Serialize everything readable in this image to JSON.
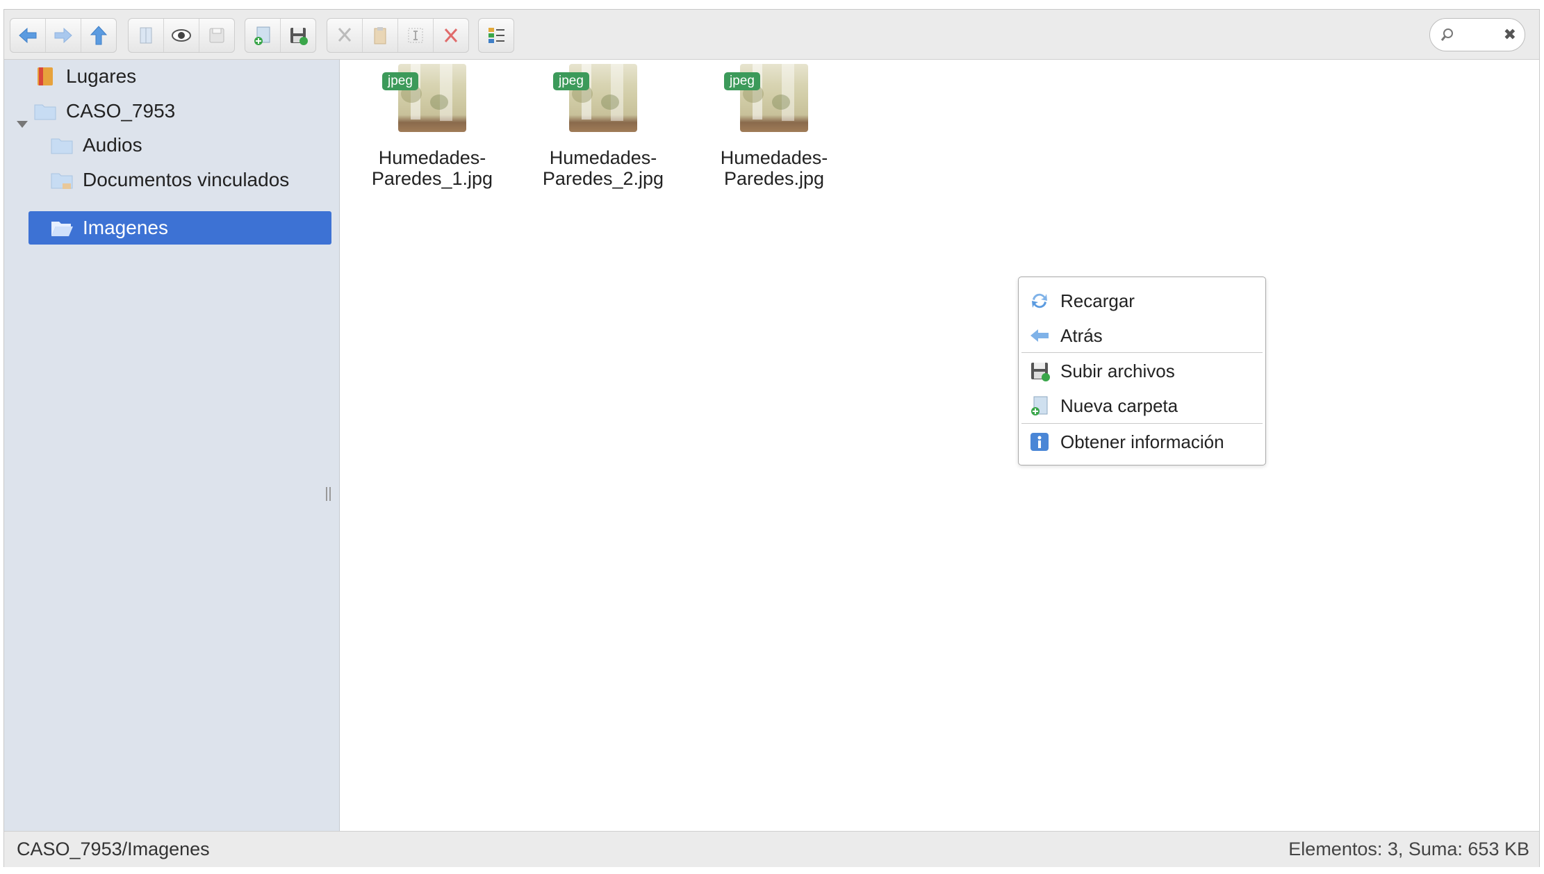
{
  "toolbar": {
    "groups": [
      [
        "back-arrow-icon",
        "forward-arrow-icon",
        "up-arrow-icon"
      ],
      [
        "open-icon",
        "preview-eye-icon",
        "download-icon"
      ],
      [
        "new-folder-icon",
        "upload-icon"
      ],
      [
        "cut-icon",
        "paste-icon",
        "rename-icon",
        "delete-icon"
      ],
      [
        "list-view-icon"
      ]
    ]
  },
  "search": {
    "placeholder": "",
    "clear_glyph": "✖"
  },
  "sidebar": {
    "items": [
      {
        "label": "Lugares",
        "icon": "places-icon"
      },
      {
        "label": "CASO_7953",
        "icon": "folder-icon"
      },
      {
        "label": "Audios",
        "icon": "folder-icon"
      },
      {
        "label": "Documentos vinculados",
        "icon": "linked-folder-icon"
      },
      {
        "label": "Imagenes",
        "icon": "open-folder-icon",
        "selected": true
      }
    ]
  },
  "files": [
    {
      "name_line1": "Humedades-",
      "name_line2": "Paredes_1.jpg",
      "type": "jpeg"
    },
    {
      "name_line1": "Humedades-",
      "name_line2": "Paredes_2.jpg",
      "type": "jpeg"
    },
    {
      "name_line1": "Humedades-",
      "name_line2": "Paredes.jpg",
      "type": "jpeg"
    }
  ],
  "context_menu": {
    "items": [
      {
        "label": "Recargar",
        "icon": "reload-icon"
      },
      {
        "label": "Atrás",
        "icon": "back-icon"
      },
      {
        "label": "Subir archivos",
        "icon": "upload-icon"
      },
      {
        "label": "Nueva carpeta",
        "icon": "new-folder-icon"
      },
      {
        "label": "Obtener información",
        "icon": "info-icon"
      }
    ]
  },
  "status": {
    "path": "CASO_7953/Imagenes",
    "summary": "Elementos: 3, Suma: 653 KB"
  },
  "colors": {
    "selection": "#3d72d4",
    "badge": "#3c9a5a",
    "sidebar_bg": "#dde3ec"
  }
}
